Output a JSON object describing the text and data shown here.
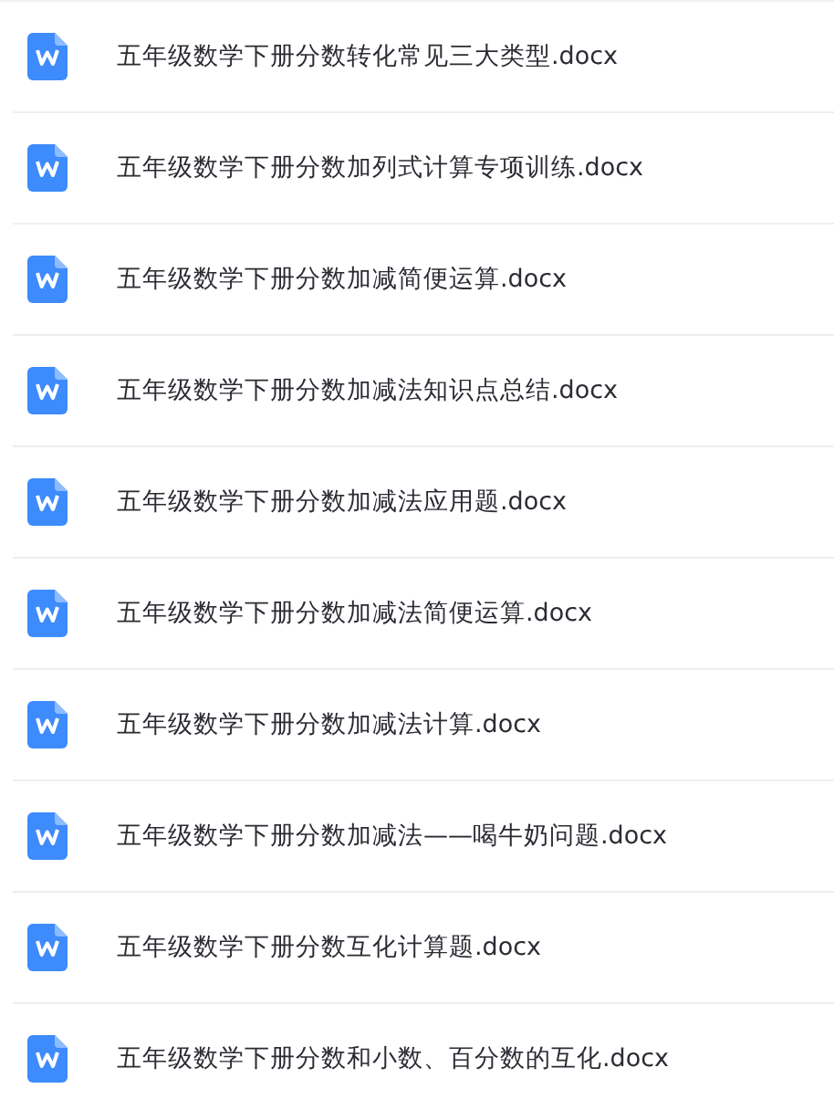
{
  "files": [
    {
      "name": "五年级数学下册分数转化常见三大类型.docx",
      "kind": "word"
    },
    {
      "name": "五年级数学下册分数加列式计算专项训练.docx",
      "kind": "word"
    },
    {
      "name": "五年级数学下册分数加减简便运算.docx",
      "kind": "word"
    },
    {
      "name": "五年级数学下册分数加减法知识点总结.docx",
      "kind": "word"
    },
    {
      "name": "五年级数学下册分数加减法应用题.docx",
      "kind": "word"
    },
    {
      "name": "五年级数学下册分数加减法简便运算.docx",
      "kind": "word"
    },
    {
      "name": "五年级数学下册分数加减法计算.docx",
      "kind": "word"
    },
    {
      "name": "五年级数学下册分数加减法——喝牛奶问题.docx",
      "kind": "word"
    },
    {
      "name": "五年级数学下册分数互化计算题.docx",
      "kind": "word"
    },
    {
      "name": "五年级数学下册分数和小数、百分数的互化.docx",
      "kind": "word"
    }
  ]
}
